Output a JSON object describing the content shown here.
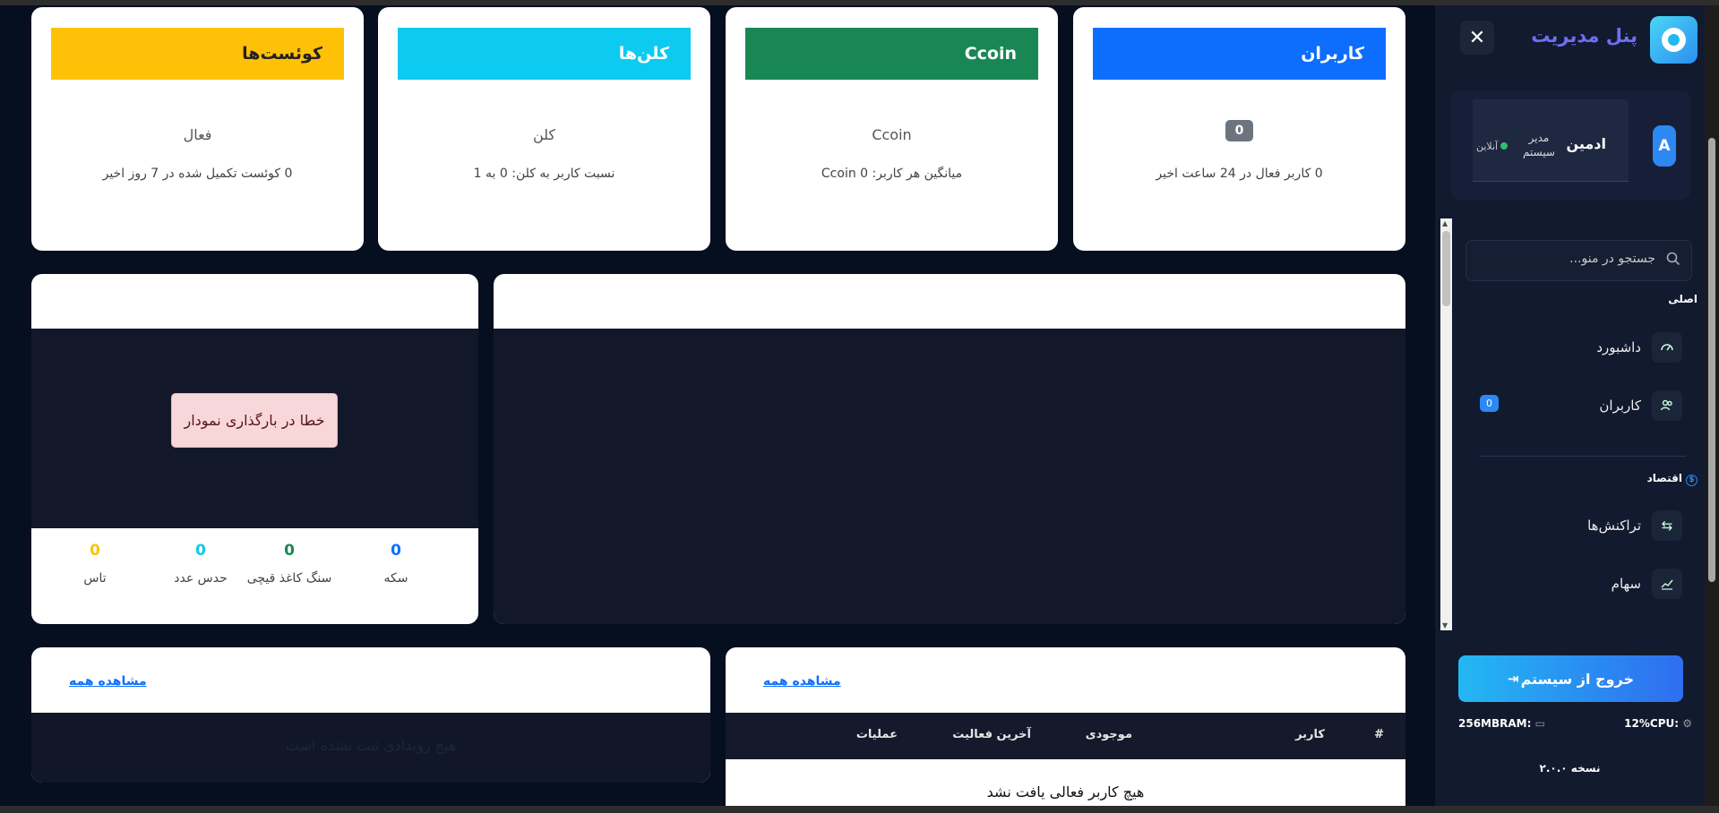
{
  "stats": [
    {
      "title": "کاربران",
      "value": "0",
      "sub": "0 کاربر فعال در 24 ساعت اخیر",
      "color": "#0d6efd"
    },
    {
      "title": "Ccoin",
      "value": "Ccoin",
      "sub": "میانگین هر کاربر: 0 Ccoin",
      "color": "#198754"
    },
    {
      "title": "کلن‌ها",
      "value": "کلن",
      "sub": "نسبت کاربر به کلن: 0 به 1",
      "color": "#0dcaf0"
    },
    {
      "title": "کوئست‌ها",
      "value": "فعال",
      "sub": "0 کوئست تکمیل شده در 7 روز اخیر",
      "color": "#ffc107"
    }
  ],
  "chart_error": "خطا در بارگذاری نمودار",
  "games": [
    {
      "label": "سکه",
      "value": "0",
      "color": "#0d6efd"
    },
    {
      "label": "سنگ کاغذ قیچی",
      "value": "0",
      "color": "#198754"
    },
    {
      "label": "حدس عدد",
      "value": "0",
      "color": "#0dcaf0"
    },
    {
      "label": "تاس",
      "value": "0",
      "color": "#ffc107"
    }
  ],
  "users_table": {
    "view_all": "مشاهده همه",
    "columns": [
      "#",
      "کاربر",
      "موجودی",
      "آخرین فعالیت",
      "عملیات"
    ],
    "empty": "هیچ کاربر فعالی یافت نشد"
  },
  "events": {
    "view_all": "مشاهده همه",
    "empty": "هیچ رویدادی ثبت نشده است"
  },
  "sidebar": {
    "brand": "پنل مدیریت",
    "user": {
      "initial": "A",
      "name": "ادمین",
      "role": "مدیر سیستم",
      "status": "آنلاین"
    },
    "search_placeholder": "جستجو در منو...",
    "sections": [
      {
        "title": "اصلی",
        "items": [
          {
            "label": "داشبورد"
          },
          {
            "label": "کاربران",
            "badge": "0"
          }
        ]
      },
      {
        "title": "اقتصاد",
        "items": [
          {
            "label": "تراکنش‌ها"
          },
          {
            "label": "سهام"
          }
        ]
      }
    ],
    "logout": "خروج از سیستم",
    "cpu_label": "CPU:",
    "cpu_value": "12%",
    "ram_label": "RAM:",
    "ram_value": "256MB",
    "version": "نسخه ۲.۰.۰"
  }
}
